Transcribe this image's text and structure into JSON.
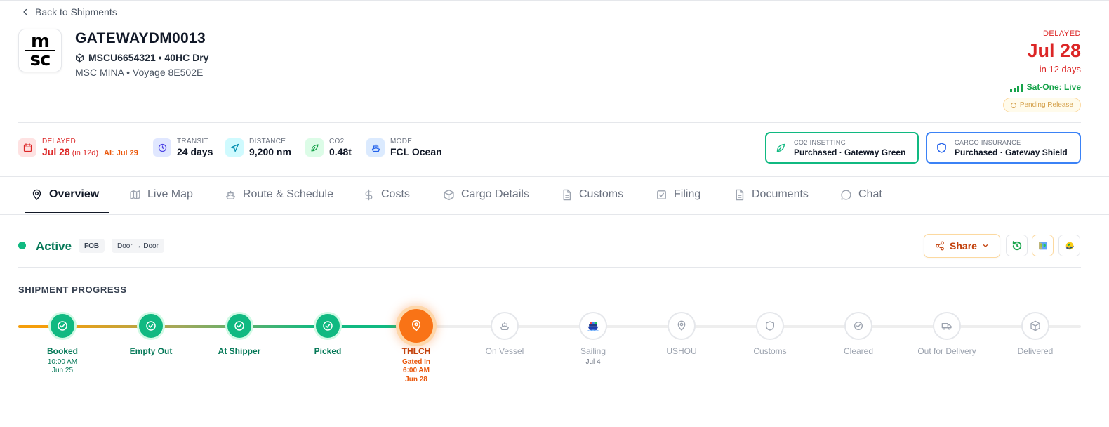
{
  "nav": {
    "back_label": "Back to Shipments"
  },
  "header": {
    "logo_line1": "m",
    "logo_line2": "sc",
    "logo_full": "msc",
    "reference": "GATEWAYDM0013",
    "container": "MSCU6654321 • 40HC Dry",
    "vessel": "MSC MINA • Voyage 8E502E"
  },
  "eta": {
    "status": "DELAYED",
    "date": "Jul 28",
    "relative": "in 12 days",
    "tracking": "Sat-One: Live",
    "release": "Pending Release"
  },
  "stats": {
    "delay": {
      "label": "DELAYED",
      "value": "Jul 28",
      "sub": "(in 12d)",
      "ai": "AI: Jul 29"
    },
    "transit": {
      "label": "TRANSIT",
      "value": "24 days"
    },
    "distance": {
      "label": "DISTANCE",
      "value": "9,200 nm"
    },
    "co2": {
      "label": "CO2",
      "value": "0.48t"
    },
    "mode": {
      "label": "MODE",
      "value": "FCL Ocean"
    }
  },
  "badges": {
    "co2_insetting": {
      "label": "CO2 INSETTING",
      "value": "Purchased · Gateway Green",
      "color": "#10b981"
    },
    "cargo_insurance": {
      "label": "CARGO INSURANCE",
      "value": "Purchased · Gateway Shield",
      "color": "#3b82f6"
    }
  },
  "tabs": [
    {
      "label": "Overview",
      "icon": "pin-icon",
      "active": true
    },
    {
      "label": "Live Map",
      "icon": "map-icon"
    },
    {
      "label": "Route & Schedule",
      "icon": "ship-icon"
    },
    {
      "label": "Costs",
      "icon": "dollar-icon"
    },
    {
      "label": "Cargo Details",
      "icon": "box-icon"
    },
    {
      "label": "Customs",
      "icon": "document-icon"
    },
    {
      "label": "Filing",
      "icon": "checkbox-icon"
    },
    {
      "label": "Documents",
      "icon": "file-icon"
    },
    {
      "label": "Chat",
      "icon": "chat-icon"
    }
  ],
  "status_bar": {
    "state": "Active",
    "incoterm": "FOB",
    "service": "Door → Door",
    "share_label": "Share"
  },
  "progress": {
    "title": "SHIPMENT PROGRESS",
    "stages": [
      {
        "label": "Booked",
        "state": "done",
        "sub1": "10:00 AM",
        "sub2": "Jun 25"
      },
      {
        "label": "Empty Out",
        "state": "done"
      },
      {
        "label": "At Shipper",
        "state": "done"
      },
      {
        "label": "Picked",
        "state": "done"
      },
      {
        "label": "THLCH",
        "state": "current",
        "sub1": "Gated In",
        "sub2": "6:00 AM",
        "sub3": "Jun 28"
      },
      {
        "label": "On Vessel",
        "state": "pending"
      },
      {
        "label": "Sailing",
        "state": "pending",
        "sub1": "Jul 4"
      },
      {
        "label": "USHOU",
        "state": "pending"
      },
      {
        "label": "Customs",
        "state": "pending"
      },
      {
        "label": "Cleared",
        "state": "pending"
      },
      {
        "label": "Out for Delivery",
        "state": "pending"
      },
      {
        "label": "Delivered",
        "state": "pending"
      }
    ]
  },
  "colors": {
    "delayed": "#dc2626",
    "active": "#10b981",
    "current": "#f97316",
    "track_start": "#f59e0b"
  }
}
